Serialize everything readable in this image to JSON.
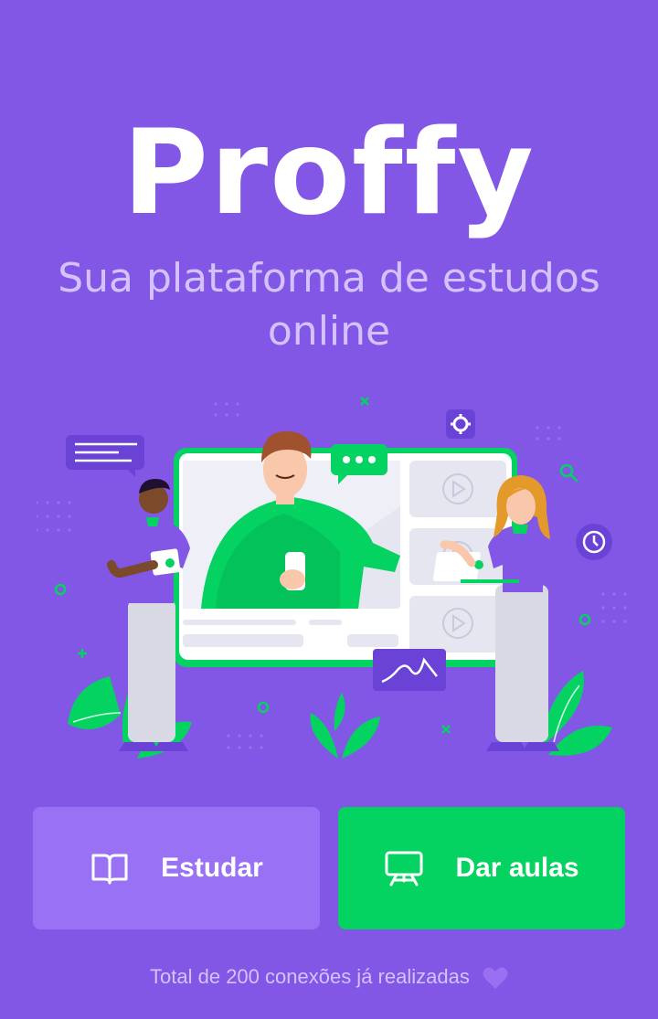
{
  "app": {
    "logo_text": "Proffy",
    "subtitle": "Sua plataforma de estudos online"
  },
  "actions": {
    "study_label": "Estudar",
    "teach_label": "Dar aulas"
  },
  "footer": {
    "connections_text": "Total de 200 conexões já realizadas"
  },
  "icons": {
    "study": "book-open-icon",
    "teach": "presentation-board-icon",
    "footer": "heart-icon"
  },
  "colors": {
    "background": "#8257e5",
    "primary_light": "#9871f5",
    "secondary": "#04d361",
    "text_light": "#d4c2ff"
  }
}
